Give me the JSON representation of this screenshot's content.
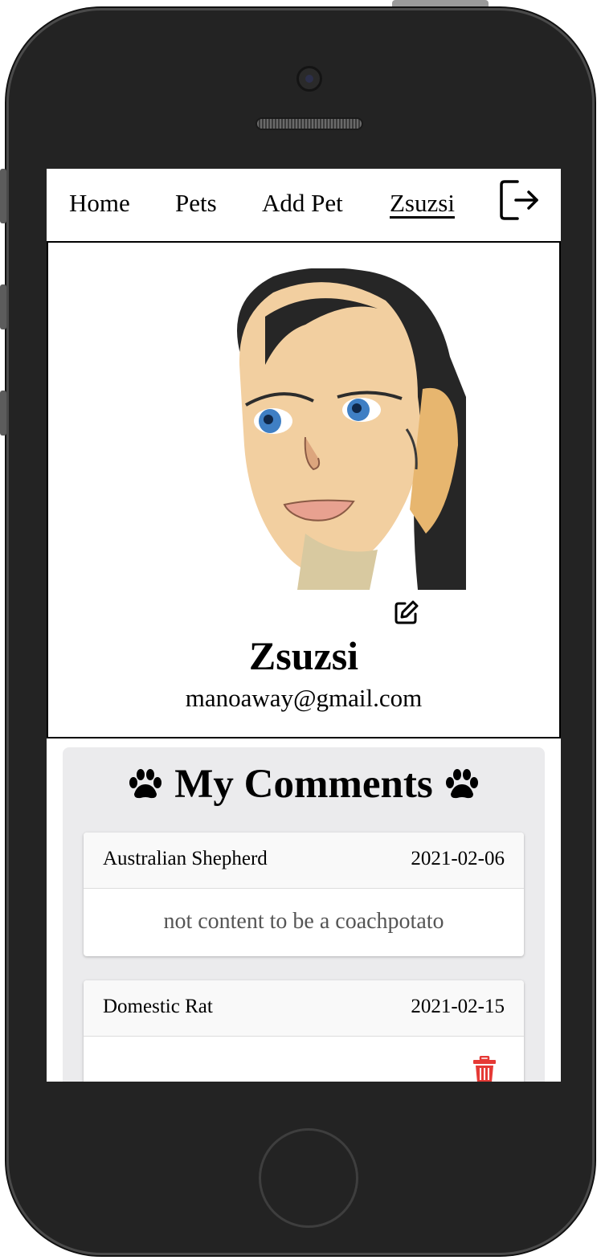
{
  "nav": {
    "items": [
      {
        "label": "Home"
      },
      {
        "label": "Pets"
      },
      {
        "label": "Add Pet"
      },
      {
        "label": "Zsuzsi",
        "active": true
      }
    ],
    "logout_icon": "logout-icon"
  },
  "profile": {
    "name": "Zsuzsi",
    "email": "manoaway@gmail.com",
    "edit_icon": "edit-icon"
  },
  "comments": {
    "title": "My Comments",
    "icon": "paw-icon",
    "items": [
      {
        "pet": "Australian Shepherd",
        "date": "2021-02-06",
        "text": "not content to be a coachpotato"
      },
      {
        "pet": "Domestic Rat",
        "date": "2021-02-15",
        "text": ""
      }
    ]
  },
  "colors": {
    "phone_body": "#232323",
    "comments_bg": "#ebebed",
    "delete_red": "#e53935"
  }
}
